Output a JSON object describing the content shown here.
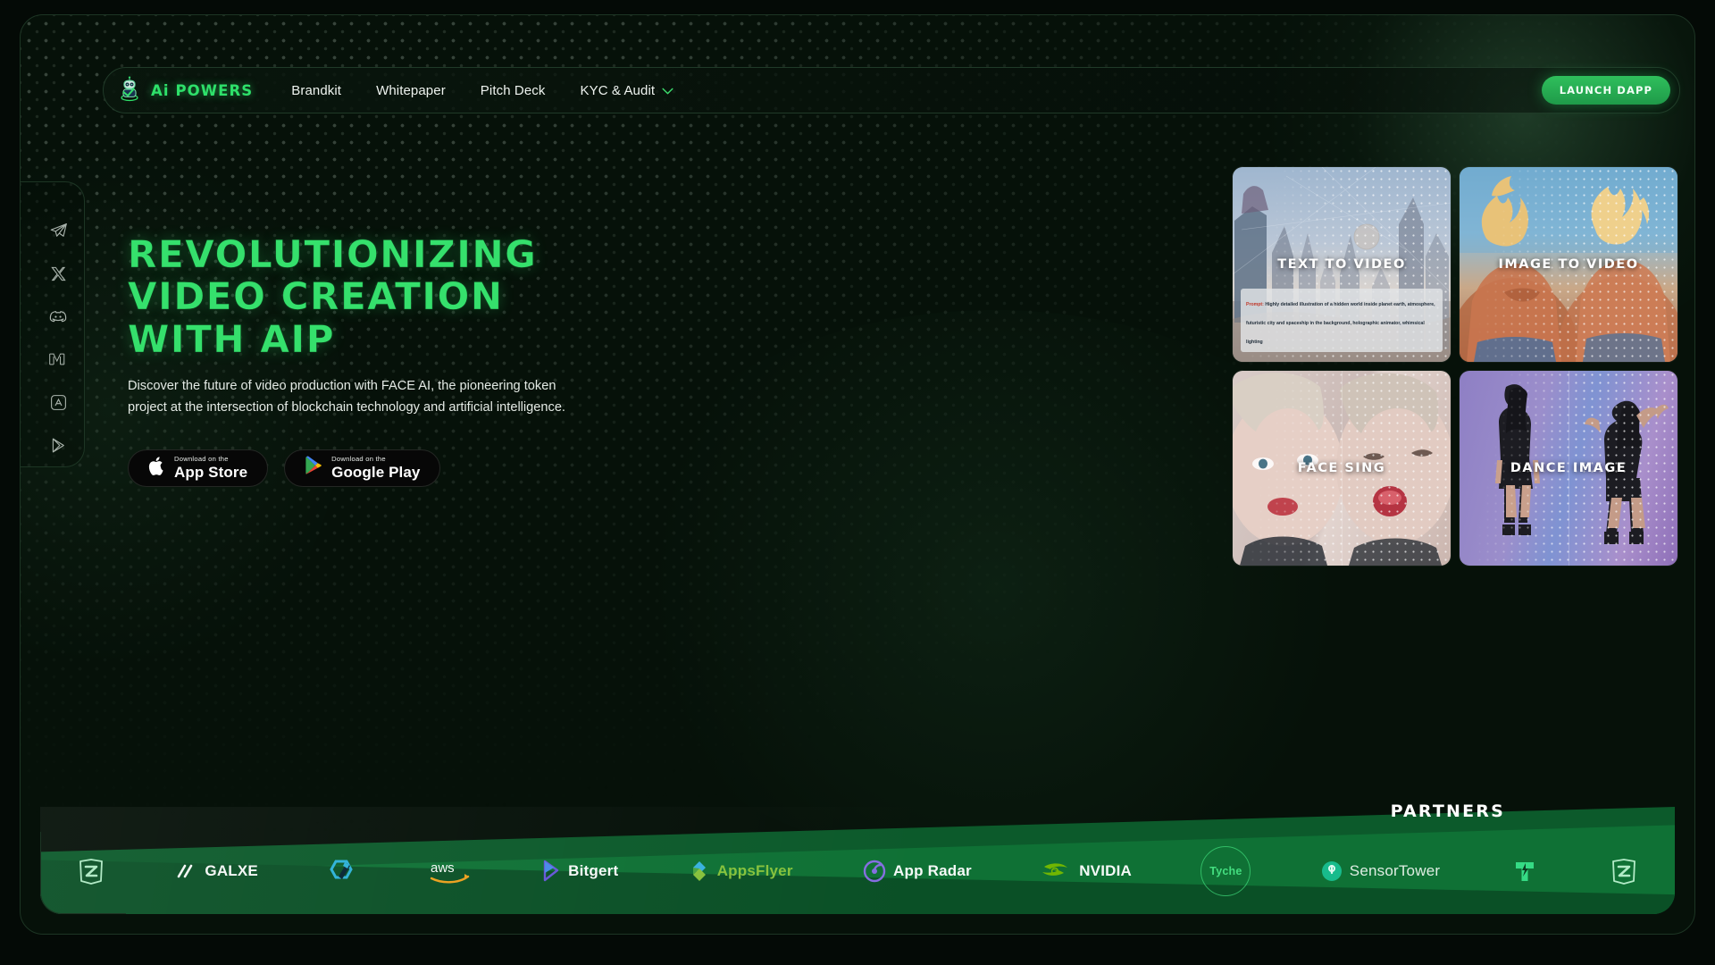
{
  "brand": {
    "name": "Ai POWERS",
    "logo_icon": "robot-mascot-icon",
    "accent": "#2ee06a"
  },
  "nav": {
    "links": [
      {
        "label": "Brandkit",
        "icon": ""
      },
      {
        "label": "Whitepaper",
        "icon": ""
      },
      {
        "label": "Pitch Deck",
        "icon": ""
      },
      {
        "label": "KYC & Audit",
        "icon": "chevron-down-icon"
      }
    ],
    "cta": {
      "label": "LAUNCH DAPP",
      "color": "#2fbf5c"
    }
  },
  "social_rail": [
    {
      "name": "telegram-icon",
      "label": "Telegram"
    },
    {
      "name": "x-twitter-icon",
      "label": "X"
    },
    {
      "name": "discord-icon",
      "label": "Discord"
    },
    {
      "name": "medium-icon",
      "label": "Medium"
    },
    {
      "name": "app-store-icon",
      "label": "App Store"
    },
    {
      "name": "google-play-icon",
      "label": "Google Play"
    }
  ],
  "hero": {
    "headline_line1": "Revolutionizing",
    "headline_line2": "Video Creation",
    "headline_line3": "With AiP",
    "subcopy": "Discover the future of video production with FACE AI, the pioneering token project at the intersection of blockchain technology and artificial intelligence.",
    "stores": [
      {
        "small": "Download on the",
        "big": "App Store",
        "icon": "apple-logo-icon"
      },
      {
        "small": "Download on the",
        "big": "Google Play",
        "icon": "google-play-triangle-icon"
      }
    ]
  },
  "showcase": [
    {
      "id": "text-to-video",
      "label": "Text to Video",
      "prompt_label": "Prompt:",
      "prompt_text": " Highly detailed illustration of a hidden world inside planet earth, atmosphere, futuristic city and spaceship in the background, holographic animator, whimsical lighting",
      "scene": "futuristic sci-fi city with spires, planet and spaceship in hazy blue sky"
    },
    {
      "id": "image-to-video",
      "label": "Image to Video",
      "scene": "two anime characters with spiky blonde hair seen from behind against blue sky"
    },
    {
      "id": "face-sing",
      "label": "Face Sing",
      "scene": "split-screen close-up portrait of a blonde woman singing"
    },
    {
      "id": "dance-image",
      "label": "Dance Image",
      "scene": "two dancers in black outfits on a purple and blue gradient backdrop"
    }
  ],
  "partners": {
    "title": "Partners",
    "logos": [
      {
        "name": "zealy-logo",
        "text": "",
        "mark": "zealy"
      },
      {
        "name": "galxe-logo",
        "text": "GALXE",
        "mark": "galxe"
      },
      {
        "name": "hex-logo",
        "text": "",
        "mark": "hex"
      },
      {
        "name": "aws-logo",
        "text": "aws",
        "mark": "aws"
      },
      {
        "name": "bitgert-logo",
        "text": "Bitgert",
        "mark": "bitgert"
      },
      {
        "name": "appsflyer-logo",
        "text": "AppsFlyer",
        "mark": "appsflyer"
      },
      {
        "name": "app-radar-logo",
        "text": "App Radar",
        "mark": "appradar"
      },
      {
        "name": "nvidia-logo",
        "text": "NVIDIA",
        "mark": "nvidia"
      },
      {
        "name": "tyche-logo",
        "text": "Tyche",
        "mark": "tyche"
      },
      {
        "name": "sensortower-logo",
        "text": "SensorTower",
        "mark": "sensortower"
      },
      {
        "name": "t-logo",
        "text": "",
        "mark": "tmark"
      },
      {
        "name": "zealy-logo-2",
        "text": "",
        "mark": "zealy"
      }
    ]
  }
}
